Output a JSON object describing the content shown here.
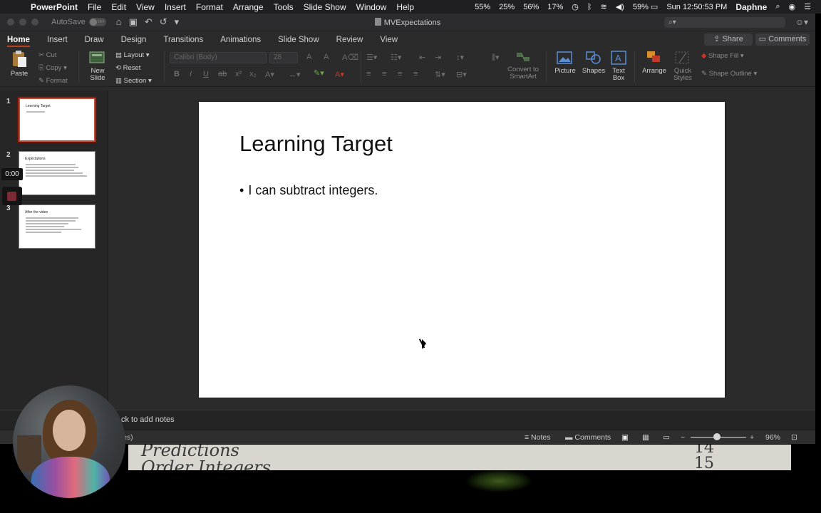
{
  "menubar": {
    "app_name": "PowerPoint",
    "items": [
      "File",
      "Edit",
      "View",
      "Insert",
      "Format",
      "Arrange",
      "Tools",
      "Slide Show",
      "Window",
      "Help"
    ],
    "status": [
      "55%",
      "25%",
      "56%",
      "17%"
    ],
    "battery": "59%",
    "clock": "Sun 12:50:53 PM",
    "user": "Daphne"
  },
  "titlebar": {
    "autosave_label": "AutoSave",
    "autosave_state": "OFF",
    "document_title": "MVExpectations"
  },
  "tabs": {
    "items": [
      "Home",
      "Insert",
      "Draw",
      "Design",
      "Transitions",
      "Animations",
      "Slide Show",
      "Review",
      "View"
    ],
    "active": "Home",
    "share": "Share",
    "comments": "Comments"
  },
  "ribbon": {
    "paste": "Paste",
    "cut": "Cut",
    "copy": "Copy",
    "format": "Format",
    "new_slide_1": "New",
    "new_slide_2": "Slide",
    "layout": "Layout",
    "reset": "Reset",
    "section": "Section",
    "font_name": "Calibri (Body)",
    "font_size": "28",
    "convert_1": "Convert to",
    "convert_2": "SmartArt",
    "picture": "Picture",
    "shapes": "Shapes",
    "text_box_1": "Text",
    "text_box_2": "Box",
    "arrange": "Arrange",
    "quick_styles_1": "Quick",
    "quick_styles_2": "Styles",
    "shape_fill": "Shape Fill",
    "shape_outline": "Shape Outline"
  },
  "thumbnails": [
    {
      "number": "1",
      "title": "Learning Target"
    },
    {
      "number": "2",
      "title": "Expectations"
    },
    {
      "number": "3",
      "title": "After the video"
    }
  ],
  "slide": {
    "title": "Learning Target",
    "bullet": "I can subtract integers."
  },
  "notes": {
    "placeholder": "ck to add notes"
  },
  "status": {
    "left": "es)",
    "notes": "Notes",
    "comments": "Comments",
    "zoom": "96%"
  },
  "recorder": {
    "timer": "0:00"
  },
  "webcam": {
    "board_line1": "Predictions",
    "board_line2": "Order Integers",
    "board_num1": "14",
    "board_num2": "15"
  },
  "colors": {
    "active_tab_underline": "#c43e1c",
    "selected_thumb_border": "#c84a33",
    "record_button": "#7c2a34"
  }
}
